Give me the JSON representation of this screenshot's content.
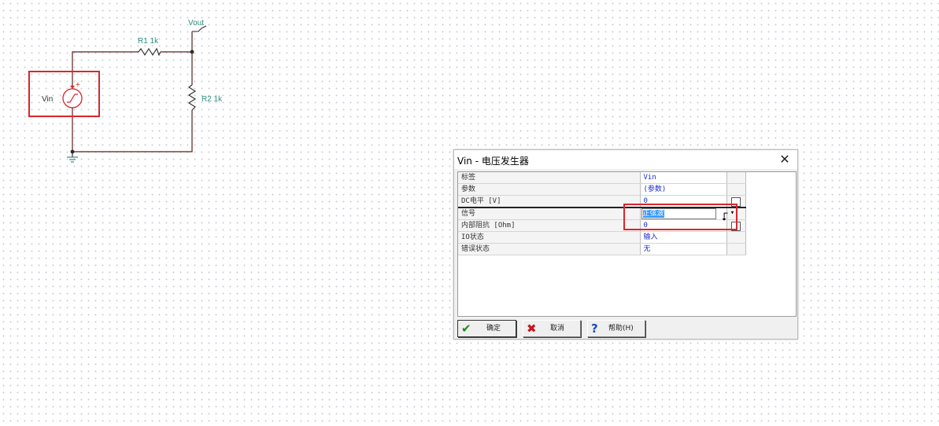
{
  "schematic": {
    "vout_label": "Vout",
    "r1_label": "R1 1k",
    "r2_label": "R2 1k",
    "vin_label": "Vin",
    "plus_sign": "+"
  },
  "dialog": {
    "title": "Vin - 电压发生器",
    "close_symbol": "✕",
    "properties": [
      {
        "label": "标签",
        "value": "Vin"
      },
      {
        "label": "参数",
        "value": "(参数)"
      },
      {
        "label": "DC电平 [V]",
        "value": "0"
      },
      {
        "label": "信号",
        "value": "正弦波"
      },
      {
        "label": "内部阻抗 [Ohm]",
        "value": "0"
      },
      {
        "label": "IO状态",
        "value": "输入"
      },
      {
        "label": "错误状态",
        "value": "无"
      }
    ],
    "buttons": {
      "ok": "确定",
      "cancel": "取消",
      "help": "帮助(H)"
    }
  },
  "colors": {
    "wire": "#5a1e1e",
    "component_label": "#2f8f7f",
    "highlight": "#d9262b",
    "value_text": "#1a2bd0",
    "selection": "#3399ff"
  },
  "icons": {
    "ok": "check-icon",
    "cancel": "x-icon",
    "help": "question-icon"
  }
}
